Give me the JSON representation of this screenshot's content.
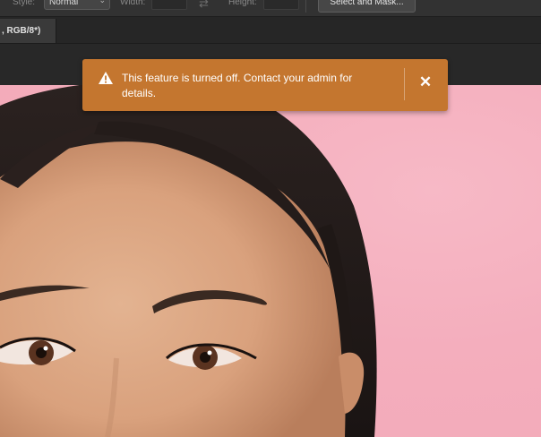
{
  "options_bar": {
    "style_label": "Style:",
    "style_value": "Normal",
    "width_label": "Width:",
    "height_label": "Height:",
    "select_and_mask_label": "Select and Mask..."
  },
  "document_tab": {
    "title": ", RGB/8*)"
  },
  "toast": {
    "message": "This feature is turned off. Contact your admin for details.",
    "close_glyph": "✕",
    "background_color": "#c4762f"
  },
  "canvas": {
    "background_color": "#f4aebd"
  }
}
